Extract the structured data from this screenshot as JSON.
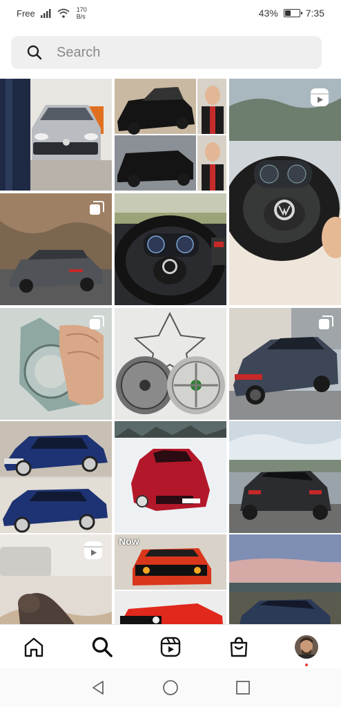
{
  "status_bar": {
    "carrier": "Free",
    "speed_value": "170",
    "speed_unit": "B/s",
    "battery": "43%",
    "battery_level": 0.43,
    "time": "7:35"
  },
  "search": {
    "placeholder": "Search"
  },
  "grid": {
    "overlay_text": "Now"
  },
  "bottom_nav": {
    "items": [
      "home-icon",
      "search-icon",
      "reels-icon",
      "shop-icon",
      "profile-avatar"
    ]
  },
  "system_nav": {
    "items": [
      "back-icon",
      "home-circle-icon",
      "recents-icon"
    ]
  }
}
